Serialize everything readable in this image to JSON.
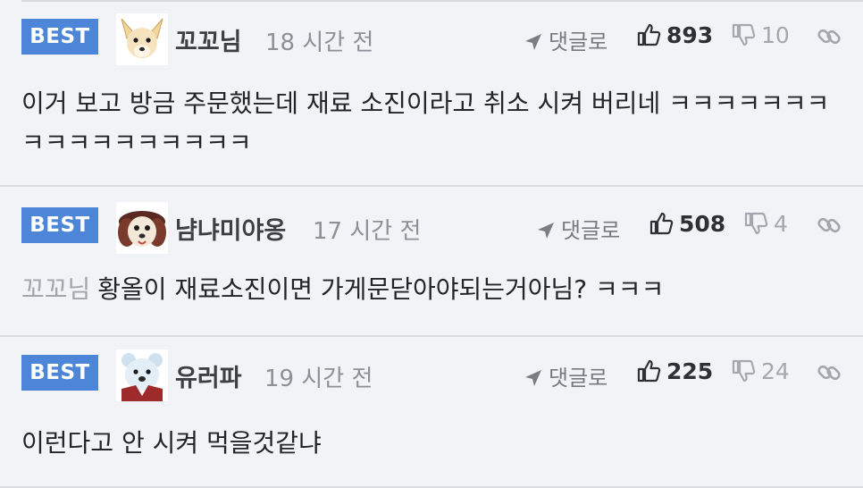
{
  "colors": {
    "background": "#f1f3f7",
    "best_badge": "#4d86d8",
    "divider": "#d9dce1"
  },
  "comments": [
    {
      "badge": "BEST",
      "avatar_icon": "chihuahua-avatar-icon",
      "nickname": "꼬꼬님",
      "time": "18 시간 전",
      "reply_label": "댓글로",
      "likes": "893",
      "dislikes": "10",
      "mention": "",
      "text": "이거 보고 방금 주문했는데 재료 소진이라고 취소 시켜 버리네 ㅋㅋㅋㅋㅋㅋㅋㅋㅋㅋㅋㅋㅋㅋㅋㅋㅋ"
    },
    {
      "badge": "BEST",
      "avatar_icon": "puppy-avatar-icon",
      "nickname": "냠냐미야옹",
      "time": "17 시간 전",
      "reply_label": "댓글로",
      "likes": "508",
      "dislikes": "4",
      "mention": "꼬꼬님",
      "text": "황올이 재료소진이면 가게문닫아야되는거아님? ㅋㅋㅋ"
    },
    {
      "badge": "BEST",
      "avatar_icon": "polar-bear-avatar-icon",
      "nickname": "유러파",
      "time": "19 시간 전",
      "reply_label": "댓글로",
      "likes": "225",
      "dislikes": "24",
      "mention": "",
      "text": "이런다고 안 시켜 먹을것같냐"
    }
  ]
}
